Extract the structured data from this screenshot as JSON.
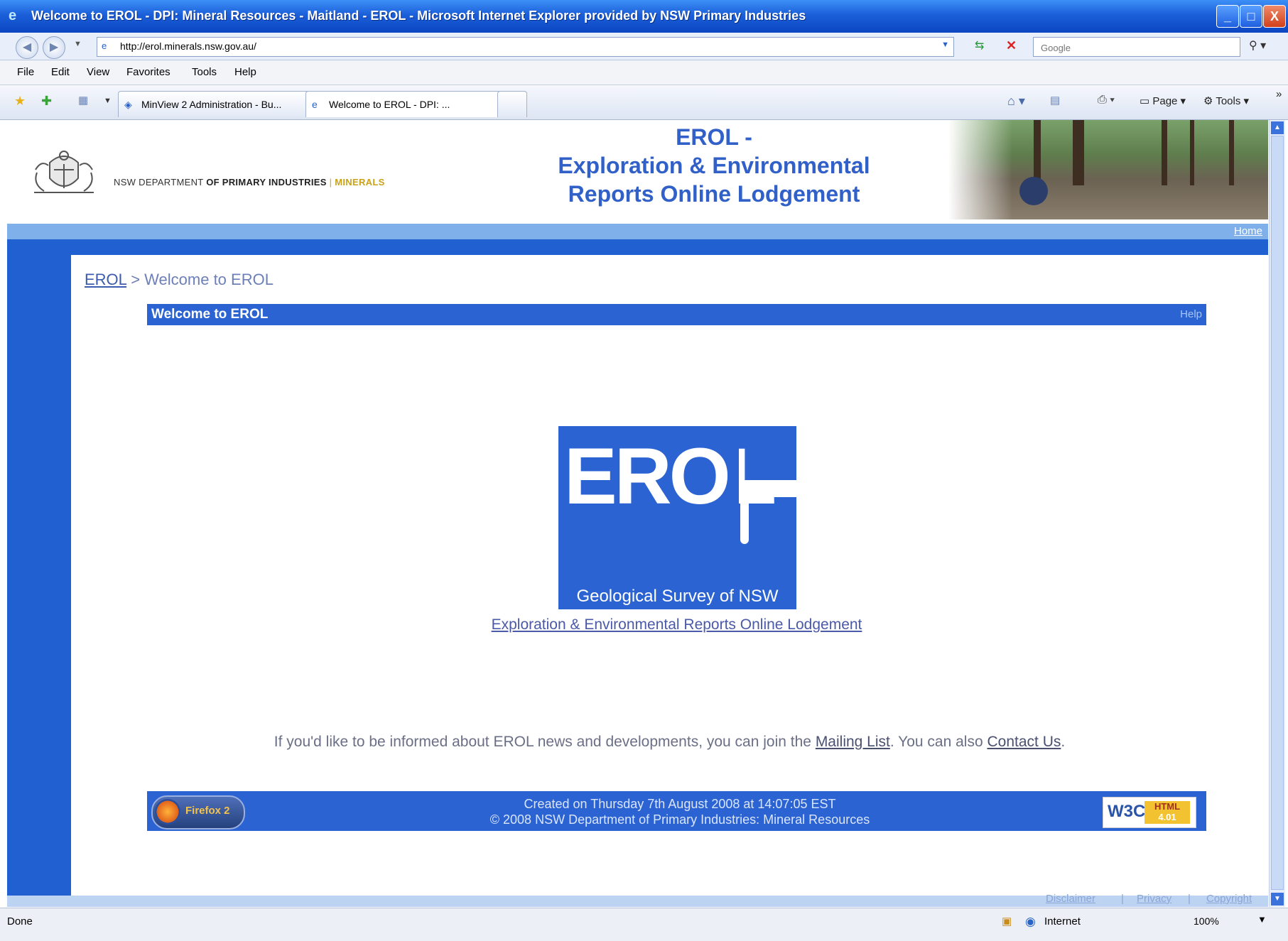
{
  "window": {
    "title": "Welcome to EROL - DPI: Mineral Resources - Maitland - EROL - Microsoft Internet Explorer provided by NSW Primary Industries",
    "minimize": "_",
    "maximize": "□",
    "close": "X"
  },
  "address": {
    "url": "http://erol.minerals.nsw.gov.au/",
    "search_placeholder": "Google"
  },
  "menu": [
    "File",
    "Edit",
    "View",
    "Favorites",
    "Tools",
    "Help"
  ],
  "tabs": [
    {
      "label": "MinView 2 Administration - Bu..."
    },
    {
      "label": "Welcome to EROL - DPI: ..."
    }
  ],
  "toolbar": {
    "page": "Page",
    "tools": "Tools"
  },
  "header": {
    "dept_prefix": "NSW DEPARTMENT ",
    "dept_bold": "OF PRIMARY INDUSTRIES",
    "dept_sep": " | ",
    "dept_minerals": "MINERALS",
    "title_line1": "EROL -",
    "title_line2": "Exploration & Environmental",
    "title_line3": "Reports Online Lodgement",
    "home_link": "Home"
  },
  "breadcrumb": {
    "root": "EROL",
    "sep": " > ",
    "current": "Welcome to EROL"
  },
  "welcome": {
    "title": "Welcome to EROL",
    "help": "Help"
  },
  "logo": {
    "text": "EROL",
    "org": "Geological Survey of NSW",
    "subtitle_link": "Exploration & Environmental Reports Online Lodgement"
  },
  "news": {
    "prefix": "If you'd like to be informed about EROL news and developments, you can join the ",
    "mailing_list": "Mailing List",
    "middle": ". You can also ",
    "contact": "Contact Us",
    "suffix": "."
  },
  "footer": {
    "firefox": "Firefox 2",
    "created": "Created on Thursday 7th August 2008 at 14:07:05 EST",
    "copyright": "© 2008 NSW Department of Primary Industries: Mineral Resources",
    "w3c": "W3C",
    "html_badge_1": "HTML",
    "html_badge_2": "4.01"
  },
  "footer_links": {
    "disclaimer": "Disclaimer",
    "privacy": "Privacy",
    "copyright": "Copyright",
    "sep": "|"
  },
  "status": {
    "text": "Done",
    "zone": "Internet",
    "zoom": "100%"
  }
}
